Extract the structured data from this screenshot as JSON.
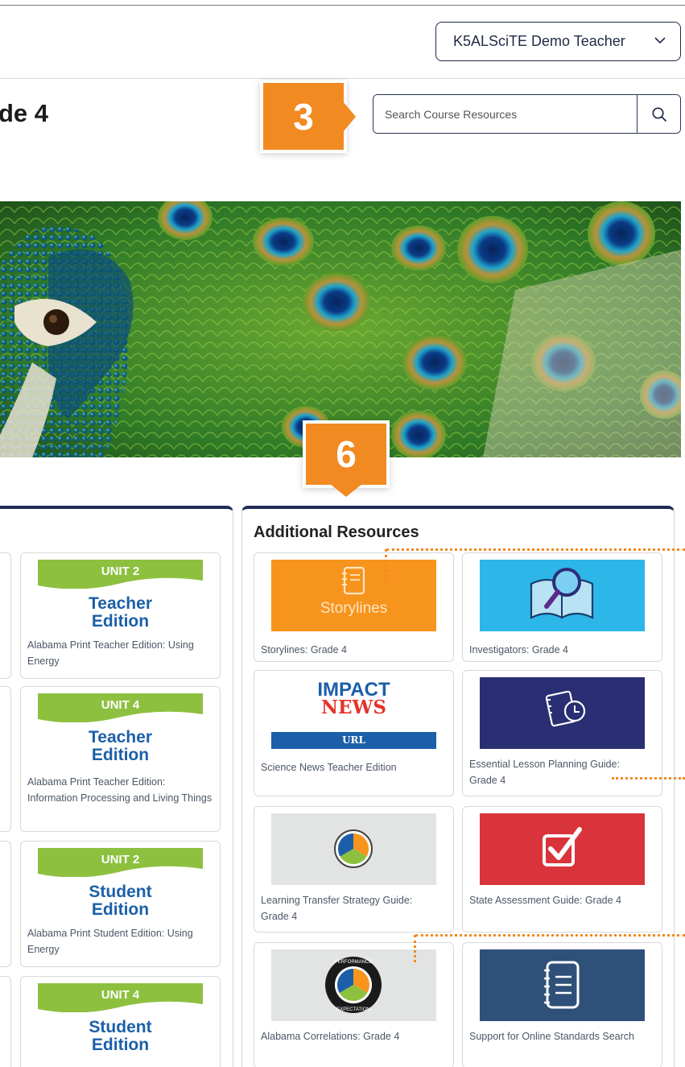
{
  "header": {
    "user_menu_label": "K5ALSciTE Demo Teacher",
    "page_title": "de 4"
  },
  "search": {
    "placeholder": "Search Course Resources"
  },
  "callouts": {
    "search": "3",
    "additional_resources": "6"
  },
  "left_panel": {
    "cards": [
      {
        "unit": "UNIT 2",
        "line1": "Teacher",
        "line2": "Edition",
        "caption": "Alabama Print Teacher Edition: Using Energy"
      },
      {
        "unit": "UNIT 4",
        "line1": "Teacher",
        "line2": "Edition",
        "caption": "Alabama Print Teacher Edition: Information Processing and Living Things"
      },
      {
        "unit": "UNIT 2",
        "line1": "Student",
        "line2": "Edition",
        "caption": "Alabama Print Student Edition: Using Energy"
      },
      {
        "unit": "UNIT 4",
        "line1": "Student",
        "line2": "Edition",
        "caption": ""
      }
    ]
  },
  "additional_resources": {
    "title": "Additional Resources",
    "cards": [
      {
        "caption": "Storylines: Grade 4",
        "thumb_label": "Storylines"
      },
      {
        "caption": "Investigators: Grade 4"
      },
      {
        "caption": "Science News Teacher Edition",
        "logo_line1": "IMPACT",
        "logo_line2": "NEWS",
        "logo_line3": "URL"
      },
      {
        "caption": "Essential Lesson Planning Guide: Grade 4"
      },
      {
        "caption": "Learning Transfer Strategy Guide: Grade 4"
      },
      {
        "caption": "State Assessment Guide: Grade 4"
      },
      {
        "caption": "Alabama Correlations: Grade 4",
        "badge_top": "PERFORMANCE",
        "badge_bottom": "EXPECTATION"
      },
      {
        "caption": "Support for Online Standards Search"
      }
    ]
  },
  "colors": {
    "accent_orange": "#f28a22",
    "navy": "#1e2b55",
    "edition_green": "#8dc03f",
    "edition_blue": "#1b5fa8"
  }
}
